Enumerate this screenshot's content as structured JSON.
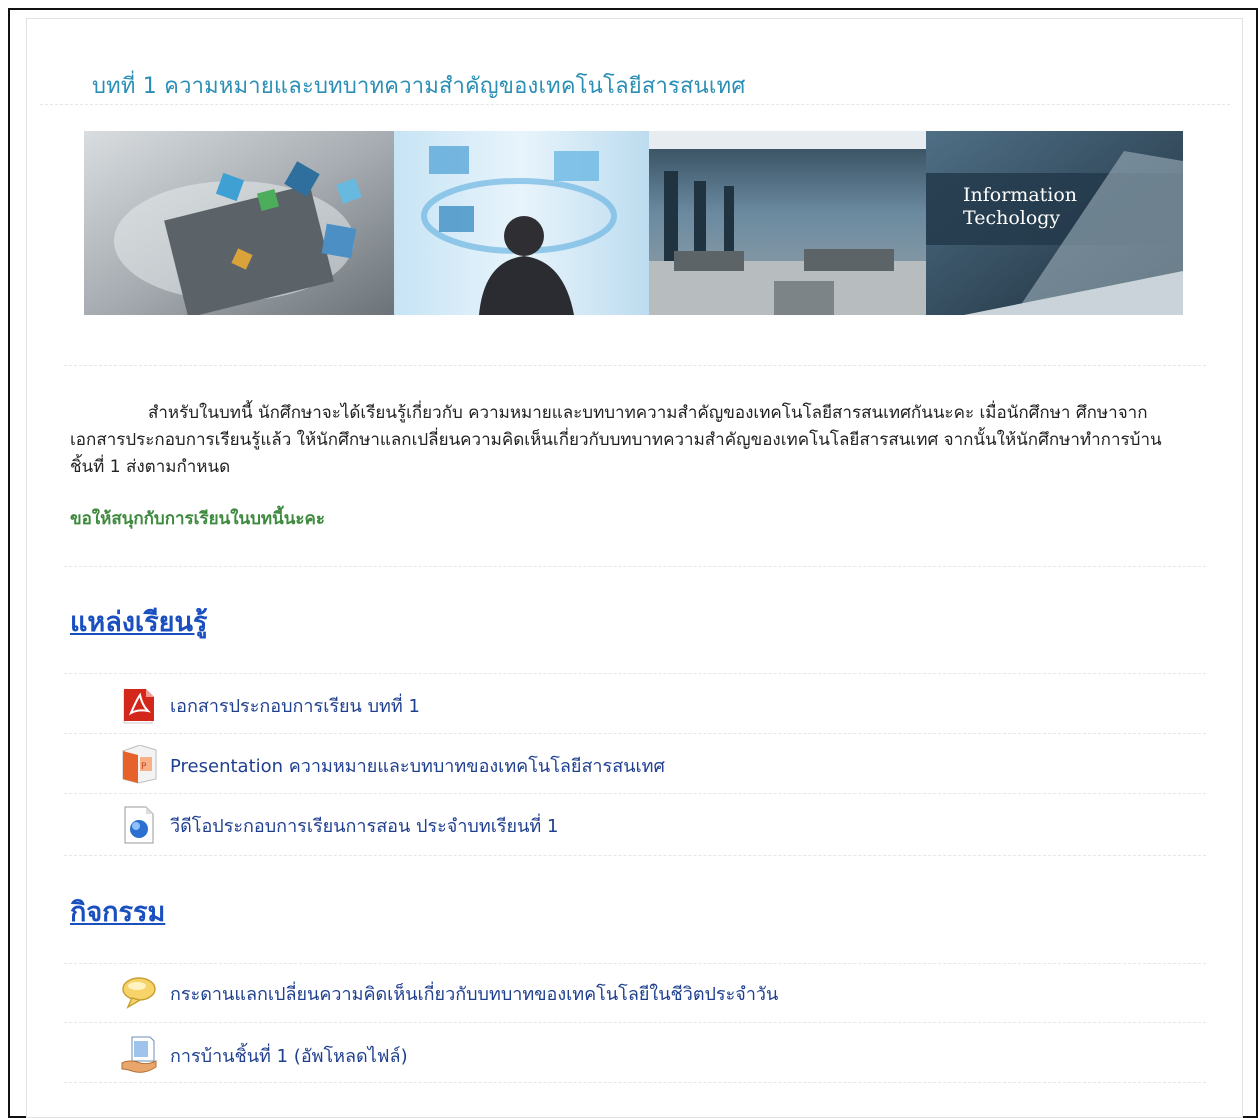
{
  "page": {
    "title": "บทที่ 1 ความหมายและบทบาทความสำคัญของเทคโนโลยีสารสนเทศ"
  },
  "banner": {
    "caption_line1": "Information",
    "caption_line2": "Techology"
  },
  "intro": {
    "paragraph": "สำหรับในบทนี้ นักศึกษาจะได้เรียนรู้เกี่ยวกับ ความหมายและบทบาทความสำคัญของเทคโนโลยีสารสนเทศกันนะคะ เมื่อนักศึกษา ศึกษาจากเอกสารประกอบการเรียนรู้แล้ว ให้นักศึกษาแลกเปลี่ยนความคิดเห็นเกี่ยวกับบทบาทความสำคัญของเทคโนโลยีสารสนเทศ จากนั้นให้นักศึกษาทำการบ้านชิ้นที่ 1 ส่งตามกำหนด",
    "fun_line": "ขอให้สนุกกับการเรียนในบทนี้นะคะ"
  },
  "resources": {
    "heading": "แหล่งเรียนรู้",
    "items": [
      {
        "label": "เอกสารประกอบการเรียน บทที่ 1",
        "icon": "pdf-icon"
      },
      {
        "label": "Presentation ความหมายและบทบาทของเทคโนโลยีสารสนเทศ",
        "icon": "powerpoint-icon"
      },
      {
        "label": "วีดีโอประกอบการเรียนการสอน ประจำบทเรียนที่ 1",
        "icon": "video-file-icon"
      }
    ]
  },
  "activities": {
    "heading": "กิจกรรม",
    "items": [
      {
        "label": "กระดานแลกเปลี่ยนความคิดเห็นเกี่ยวกับบทบาทของเทคโนโลยีในชีวิตประจำวัน",
        "icon": "forum-icon"
      },
      {
        "label": "การบ้านชิ้นที่ 1 (อัพโหลดไฟล์)",
        "icon": "assignment-icon"
      }
    ]
  },
  "colors": {
    "title": "#2b8fb5",
    "heading_link": "#1a4fbf",
    "item_link": "#1f3f8f",
    "fun_line": "#3e8a3e"
  }
}
